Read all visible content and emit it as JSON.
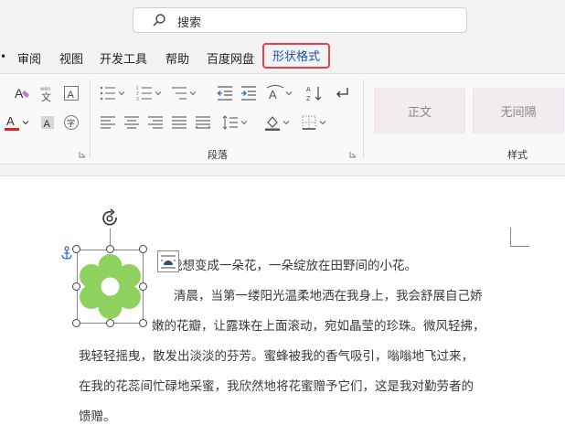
{
  "search": {
    "placeholder": "搜索"
  },
  "tabs": [
    {
      "label": "审阅"
    },
    {
      "label": "视图"
    },
    {
      "label": "开发工具"
    },
    {
      "label": "帮助"
    },
    {
      "label": "百度网盘"
    },
    {
      "label": "形状格式",
      "active": true
    }
  ],
  "ribbon": {
    "paragraph_group_label": "段落",
    "styles_group_label": "样式",
    "style_items": [
      {
        "label": "正文"
      },
      {
        "label": "无间隔"
      }
    ]
  },
  "document": {
    "lines": [
      "我想变成一朵花，一朵绽放在田野间的小花。",
      "清晨，当第一缕阳光温柔地洒在我身上，我会舒展自己娇",
      "嫩的花瓣，让露珠在上面滚动，宛如晶莹的珍珠。微风轻拂，",
      "我轻轻摇曳，散发出淡淡的芬芳。蜜蜂被我的香气吸引，嗡嗡地飞过来，",
      "在我的花蕊间忙碌地采蜜，我欣然地将花蜜赠予它们，这是我对勤劳者的",
      "馈赠。"
    ]
  },
  "colors": {
    "accent_tab_border": "#e0434f",
    "active_tab_text": "#1c56a8",
    "flower_petal": "#8fd15e",
    "font_color_bar": "#e0202c"
  },
  "icons": [
    "search-icon",
    "highlight-icon",
    "phonetic-guide-icon",
    "character-border-icon",
    "font-color-icon",
    "character-shading-icon",
    "enclose-character-icon",
    "bullets-icon",
    "numbering-icon",
    "multilevel-list-icon",
    "decrease-indent-icon",
    "increase-indent-icon",
    "chinese-layout-icon",
    "sort-icon",
    "paragraph-mark-icon",
    "align-left-icon",
    "align-center-icon",
    "align-right-icon",
    "justify-icon",
    "distributed-icon",
    "line-spacing-icon",
    "shading-icon",
    "borders-icon",
    "rotate-handle-icon",
    "anchor-icon",
    "layout-options-icon",
    "flower-shape"
  ]
}
